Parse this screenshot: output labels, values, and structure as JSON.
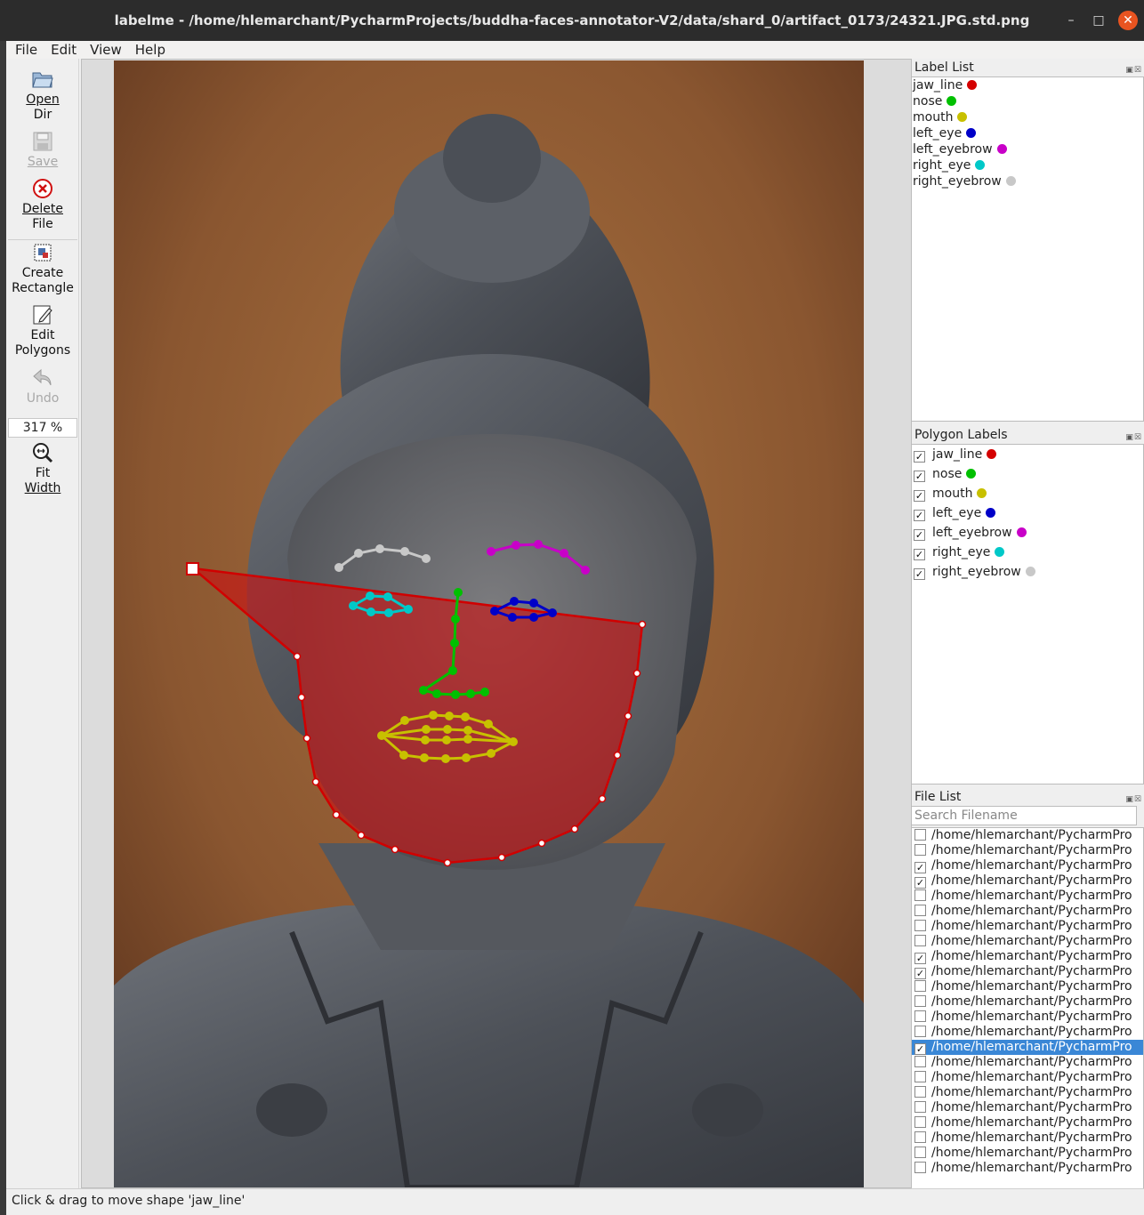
{
  "window": {
    "title": "labelme - /home/hlemarchant/PycharmProjects/buddha-faces-annotator-V2/data/shard_0/artifact_0173/24321.JPG.std.png",
    "min_label": "–",
    "max_label": "□",
    "close_label": "✕"
  },
  "menu": {
    "items": [
      "File",
      "Edit",
      "View",
      "Help"
    ]
  },
  "toolbar": {
    "open_dir": [
      "Open",
      "Dir"
    ],
    "save": "Save",
    "delete_file": [
      "Delete",
      "File"
    ],
    "create_rectangle": [
      "Create",
      "Rectangle"
    ],
    "edit_polygons": [
      "Edit",
      "Polygons"
    ],
    "undo": "Undo",
    "zoom": "317 %",
    "fit_width": [
      "Fit",
      "Width"
    ]
  },
  "label_list": {
    "title": "Label List",
    "items": [
      {
        "name": "jaw_line",
        "color": "#d40000"
      },
      {
        "name": "nose",
        "color": "#00c000"
      },
      {
        "name": "mouth",
        "color": "#c8c000"
      },
      {
        "name": "left_eye",
        "color": "#0000c8"
      },
      {
        "name": "left_eyebrow",
        "color": "#c800c8"
      },
      {
        "name": "right_eye",
        "color": "#00c8c8"
      },
      {
        "name": "right_eyebrow",
        "color": "#c8c8c8"
      }
    ]
  },
  "polygon_labels": {
    "title": "Polygon Labels",
    "items": [
      {
        "name": "jaw_line",
        "color": "#d40000",
        "checked": true
      },
      {
        "name": "nose",
        "color": "#00c000",
        "checked": true
      },
      {
        "name": "mouth",
        "color": "#c8c000",
        "checked": true
      },
      {
        "name": "left_eye",
        "color": "#0000c8",
        "checked": true
      },
      {
        "name": "left_eyebrow",
        "color": "#c800c8",
        "checked": true
      },
      {
        "name": "right_eye",
        "color": "#00c8c8",
        "checked": true
      },
      {
        "name": "right_eyebrow",
        "color": "#c8c8c8",
        "checked": true
      }
    ]
  },
  "file_list": {
    "title": "File List",
    "search_placeholder": "Search Filename",
    "items": [
      {
        "path": "/home/hlemarchant/PycharmPro",
        "checked": false,
        "selected": false
      },
      {
        "path": "/home/hlemarchant/PycharmPro",
        "checked": false,
        "selected": false
      },
      {
        "path": "/home/hlemarchant/PycharmPro",
        "checked": true,
        "selected": false
      },
      {
        "path": "/home/hlemarchant/PycharmPro",
        "checked": true,
        "selected": false
      },
      {
        "path": "/home/hlemarchant/PycharmPro",
        "checked": false,
        "selected": false
      },
      {
        "path": "/home/hlemarchant/PycharmPro",
        "checked": false,
        "selected": false
      },
      {
        "path": "/home/hlemarchant/PycharmPro",
        "checked": false,
        "selected": false
      },
      {
        "path": "/home/hlemarchant/PycharmPro",
        "checked": false,
        "selected": false
      },
      {
        "path": "/home/hlemarchant/PycharmPro",
        "checked": true,
        "selected": false
      },
      {
        "path": "/home/hlemarchant/PycharmPro",
        "checked": true,
        "selected": false
      },
      {
        "path": "/home/hlemarchant/PycharmPro",
        "checked": false,
        "selected": false
      },
      {
        "path": "/home/hlemarchant/PycharmPro",
        "checked": false,
        "selected": false
      },
      {
        "path": "/home/hlemarchant/PycharmPro",
        "checked": false,
        "selected": false
      },
      {
        "path": "/home/hlemarchant/PycharmPro",
        "checked": false,
        "selected": false
      },
      {
        "path": "/home/hlemarchant/PycharmPro",
        "checked": true,
        "selected": true
      },
      {
        "path": "/home/hlemarchant/PycharmPro",
        "checked": false,
        "selected": false
      },
      {
        "path": "/home/hlemarchant/PycharmPro",
        "checked": false,
        "selected": false
      },
      {
        "path": "/home/hlemarchant/PycharmPro",
        "checked": false,
        "selected": false
      },
      {
        "path": "/home/hlemarchant/PycharmPro",
        "checked": false,
        "selected": false
      },
      {
        "path": "/home/hlemarchant/PycharmPro",
        "checked": false,
        "selected": false
      },
      {
        "path": "/home/hlemarchant/PycharmPro",
        "checked": false,
        "selected": false
      },
      {
        "path": "/home/hlemarchant/PycharmPro",
        "checked": false,
        "selected": false
      },
      {
        "path": "/home/hlemarchant/PycharmPro",
        "checked": false,
        "selected": false
      }
    ]
  },
  "status": "Click & drag to move shape 'jaw_line'",
  "icons": {
    "open_dir": "folder-open-icon",
    "save": "save-icon",
    "delete": "delete-icon",
    "create_rectangle": "rectangle-icon",
    "edit_polygons": "edit-icon",
    "undo": "undo-icon",
    "fit_width": "zoom-fit-icon"
  }
}
